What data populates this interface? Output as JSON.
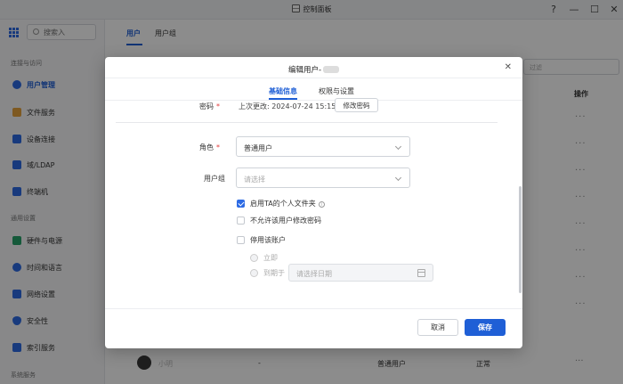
{
  "window": {
    "title": "控制面板",
    "help_label": "?",
    "minimize_label": "—",
    "maximize_label": "☐",
    "close_label": "✕"
  },
  "sidebar": {
    "search_placeholder": "搜索入",
    "sections": [
      {
        "label": "连接与访问"
      },
      {
        "label": "通用设置"
      },
      {
        "label": "系统服务"
      }
    ],
    "items": [
      {
        "label": "用户管理",
        "icon": "user-icon",
        "color": "#2d6be4",
        "active": true
      },
      {
        "label": "文件服务",
        "icon": "folder-icon",
        "color": "#e6a23c"
      },
      {
        "label": "设备连接",
        "icon": "device-icon",
        "color": "#2d6be4"
      },
      {
        "label": "域/LDAP",
        "icon": "domain-icon",
        "color": "#2d6be4"
      },
      {
        "label": "终端机",
        "icon": "terminal-icon",
        "color": "#2d6be4"
      },
      {
        "label": "硬件与电源",
        "icon": "hardware-icon",
        "color": "#27a36a"
      },
      {
        "label": "时间和语言",
        "icon": "globe-icon",
        "color": "#2d6be4"
      },
      {
        "label": "网络设置",
        "icon": "network-icon",
        "color": "#2d6be4"
      },
      {
        "label": "安全性",
        "icon": "shield-icon",
        "color": "#2d6be4"
      },
      {
        "label": "索引服务",
        "icon": "index-icon",
        "color": "#2d6be4"
      }
    ]
  },
  "main": {
    "tabs": [
      {
        "label": "用户",
        "active": true
      },
      {
        "label": "用户组"
      }
    ],
    "search_placeholder": "过滤",
    "ops_header": "操作",
    "row_menu": "···",
    "bottom_row": {
      "name": "小明",
      "email": "-",
      "role": "普通用户",
      "status": "正常"
    }
  },
  "modal": {
    "title": "编辑用户-",
    "close_label": "✕",
    "tabs": [
      {
        "label": "基础信息",
        "active": true
      },
      {
        "label": "权限与设置"
      }
    ],
    "password": {
      "label": "密码",
      "required_mark": "*",
      "last_changed": "上次更改: 2024-07-24 15:15",
      "change_button": "修改密码"
    },
    "role": {
      "label": "角色",
      "required_mark": "*",
      "value": "普通用户"
    },
    "user_group": {
      "label": "用户组",
      "placeholder": "请选择"
    },
    "options": [
      {
        "label": "启用TA的个人文件夹",
        "checked": true,
        "info": true
      },
      {
        "label": "不允许该用户修改密码",
        "checked": false
      },
      {
        "label": "停用该账户",
        "checked": false
      }
    ],
    "disable_when": {
      "immediately": "立即",
      "until": "到期于",
      "date_placeholder": "请选择日期"
    },
    "cancel_button": "取消",
    "save_button": "保存",
    "accent_color": "#1f5fd6"
  }
}
